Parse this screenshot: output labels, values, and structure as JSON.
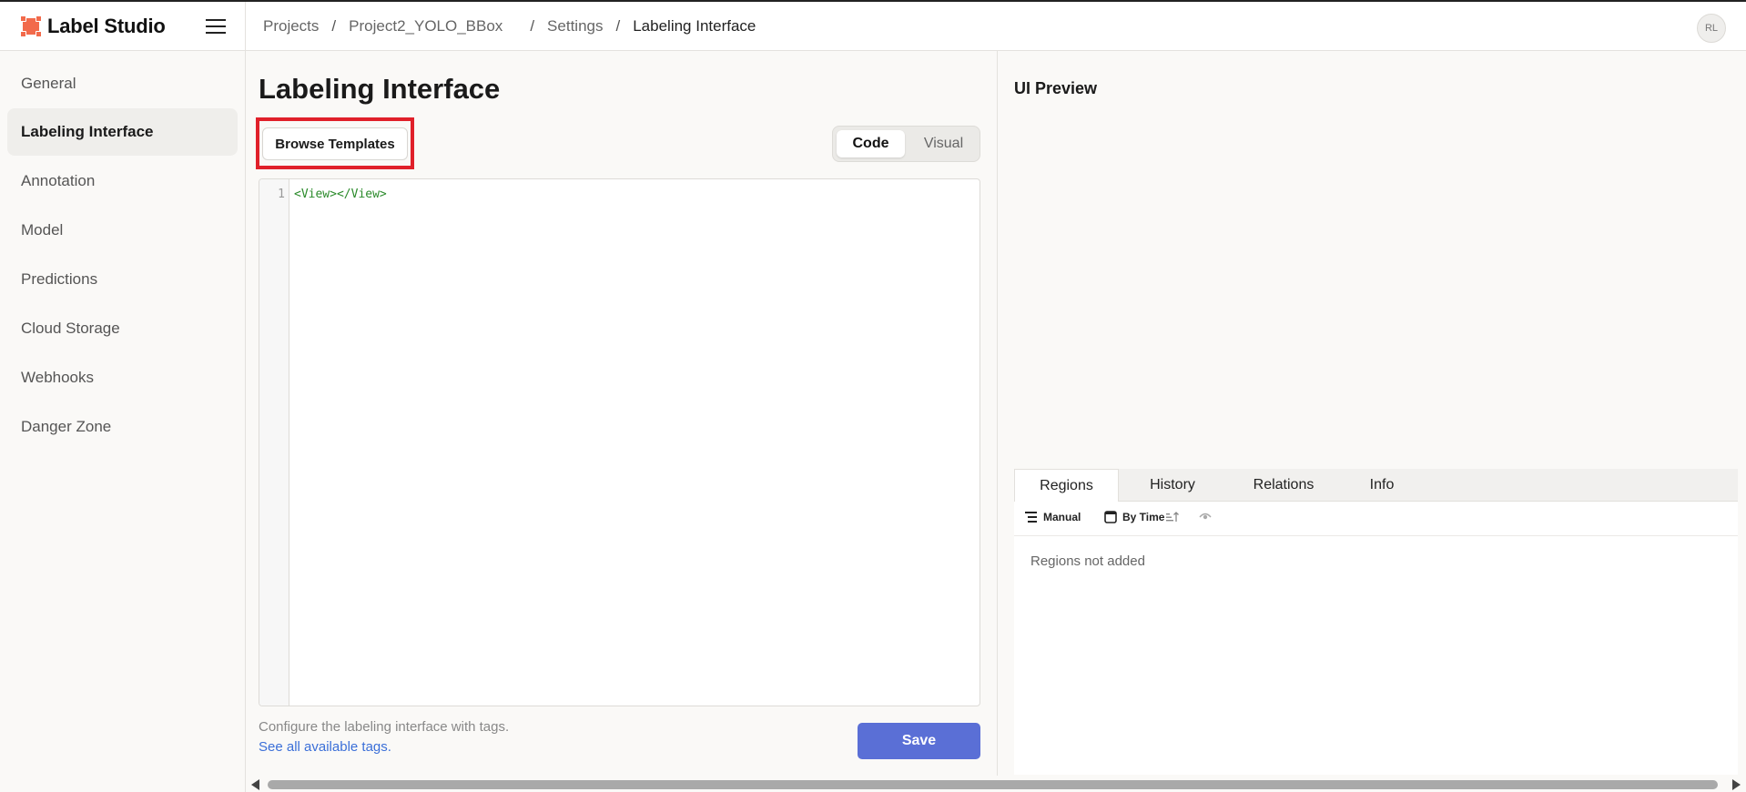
{
  "app": {
    "name": "Label Studio",
    "accent": "#f26a4b"
  },
  "header": {
    "breadcrumb": [
      "Projects",
      "Project2_YOLO_BBox",
      "Settings",
      "Labeling Interface"
    ],
    "avatar_initials": "RL"
  },
  "sidebar": {
    "items": [
      {
        "label": "General",
        "active": false
      },
      {
        "label": "Labeling Interface",
        "active": true
      },
      {
        "label": "Annotation",
        "active": false
      },
      {
        "label": "Model",
        "active": false
      },
      {
        "label": "Predictions",
        "active": false
      },
      {
        "label": "Cloud Storage",
        "active": false
      },
      {
        "label": "Webhooks",
        "active": false
      },
      {
        "label": "Danger Zone",
        "active": false
      }
    ]
  },
  "main": {
    "title": "Labeling Interface",
    "browse_label": "Browse Templates",
    "toggle": {
      "code": "Code",
      "visual": "Visual",
      "selected": "Code"
    },
    "editor": {
      "line_number": "1",
      "code": "<View></View>"
    },
    "help_text": "Configure the labeling interface with tags.",
    "tags_link": "See all available tags.",
    "save_label": "Save",
    "save_color": "#5a6fd6"
  },
  "preview": {
    "title": "UI Preview",
    "tabs": [
      "Regions",
      "History",
      "Relations",
      "Info"
    ],
    "active_tab": "Regions",
    "toolbar": {
      "manual": "Manual",
      "by_time": "By Time"
    },
    "empty_text": "Regions not added"
  }
}
